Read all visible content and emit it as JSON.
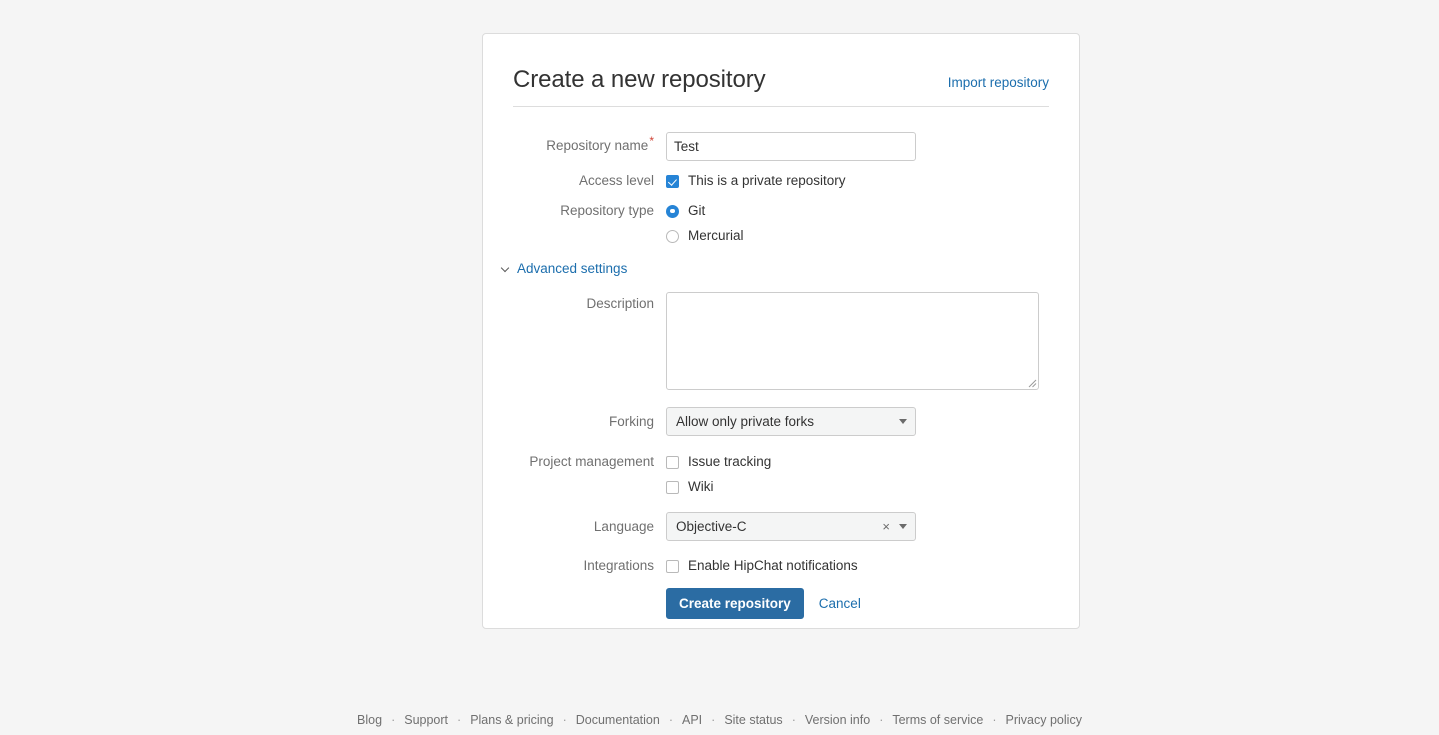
{
  "form": {
    "title": "Create a new repository",
    "import_link": "Import repository",
    "advanced_settings_label": "Advanced settings",
    "fields": {
      "repository_name": {
        "label": "Repository name",
        "required_marker": "*",
        "value": "Test",
        "placeholder": ""
      },
      "access_level": {
        "label": "Access level",
        "checkbox_label": "This is a private repository",
        "checked": true
      },
      "repository_type": {
        "label": "Repository type",
        "options": [
          {
            "label": "Git",
            "selected": true
          },
          {
            "label": "Mercurial",
            "selected": false
          }
        ]
      },
      "description": {
        "label": "Description",
        "value": "",
        "placeholder": ""
      },
      "forking": {
        "label": "Forking",
        "selected": "Allow only private forks"
      },
      "project_management": {
        "label": "Project management",
        "options": [
          {
            "label": "Issue tracking",
            "checked": false
          },
          {
            "label": "Wiki",
            "checked": false
          }
        ]
      },
      "language": {
        "label": "Language",
        "selected": "Objective-C",
        "clear_symbol": "×"
      },
      "integrations": {
        "label": "Integrations",
        "checkbox_label": "Enable HipChat notifications",
        "checked": false
      }
    },
    "actions": {
      "submit_label": "Create repository",
      "cancel_label": "Cancel"
    }
  },
  "footer": {
    "separator": "·",
    "links": [
      "Blog",
      "Support",
      "Plans & pricing",
      "Documentation",
      "API",
      "Site status",
      "Version info",
      "Terms of service",
      "Privacy policy"
    ]
  },
  "colors": {
    "page_background": "#f5f5f5",
    "card_background": "#ffffff",
    "link": "#1c6ead",
    "primary_button": "#2b6ca3",
    "control_accent": "#2684d6",
    "required_marker": "#d04437",
    "label_text": "#707070",
    "footer_text": "#707070"
  }
}
